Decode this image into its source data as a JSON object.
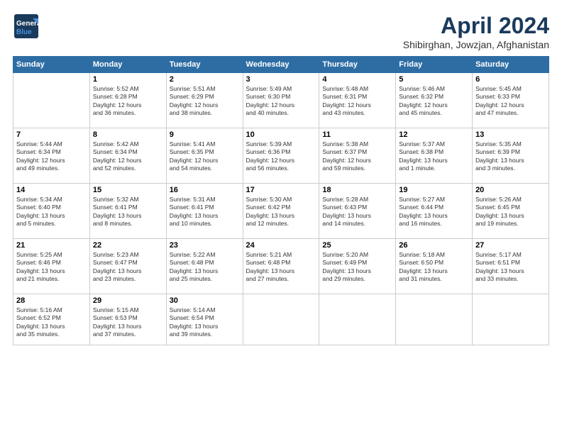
{
  "header": {
    "logo_line1": "General",
    "logo_line2": "Blue",
    "month": "April 2024",
    "location": "Shibirghan, Jowzjan, Afghanistan"
  },
  "weekdays": [
    "Sunday",
    "Monday",
    "Tuesday",
    "Wednesday",
    "Thursday",
    "Friday",
    "Saturday"
  ],
  "weeks": [
    [
      {
        "day": "",
        "text": ""
      },
      {
        "day": "1",
        "text": "Sunrise: 5:52 AM\nSunset: 6:28 PM\nDaylight: 12 hours\nand 36 minutes."
      },
      {
        "day": "2",
        "text": "Sunrise: 5:51 AM\nSunset: 6:29 PM\nDaylight: 12 hours\nand 38 minutes."
      },
      {
        "day": "3",
        "text": "Sunrise: 5:49 AM\nSunset: 6:30 PM\nDaylight: 12 hours\nand 40 minutes."
      },
      {
        "day": "4",
        "text": "Sunrise: 5:48 AM\nSunset: 6:31 PM\nDaylight: 12 hours\nand 43 minutes."
      },
      {
        "day": "5",
        "text": "Sunrise: 5:46 AM\nSunset: 6:32 PM\nDaylight: 12 hours\nand 45 minutes."
      },
      {
        "day": "6",
        "text": "Sunrise: 5:45 AM\nSunset: 6:33 PM\nDaylight: 12 hours\nand 47 minutes."
      }
    ],
    [
      {
        "day": "7",
        "text": "Sunrise: 5:44 AM\nSunset: 6:34 PM\nDaylight: 12 hours\nand 49 minutes."
      },
      {
        "day": "8",
        "text": "Sunrise: 5:42 AM\nSunset: 6:34 PM\nDaylight: 12 hours\nand 52 minutes."
      },
      {
        "day": "9",
        "text": "Sunrise: 5:41 AM\nSunset: 6:35 PM\nDaylight: 12 hours\nand 54 minutes."
      },
      {
        "day": "10",
        "text": "Sunrise: 5:39 AM\nSunset: 6:36 PM\nDaylight: 12 hours\nand 56 minutes."
      },
      {
        "day": "11",
        "text": "Sunrise: 5:38 AM\nSunset: 6:37 PM\nDaylight: 12 hours\nand 59 minutes."
      },
      {
        "day": "12",
        "text": "Sunrise: 5:37 AM\nSunset: 6:38 PM\nDaylight: 13 hours\nand 1 minute."
      },
      {
        "day": "13",
        "text": "Sunrise: 5:35 AM\nSunset: 6:39 PM\nDaylight: 13 hours\nand 3 minutes."
      }
    ],
    [
      {
        "day": "14",
        "text": "Sunrise: 5:34 AM\nSunset: 6:40 PM\nDaylight: 13 hours\nand 5 minutes."
      },
      {
        "day": "15",
        "text": "Sunrise: 5:32 AM\nSunset: 6:41 PM\nDaylight: 13 hours\nand 8 minutes."
      },
      {
        "day": "16",
        "text": "Sunrise: 5:31 AM\nSunset: 6:41 PM\nDaylight: 13 hours\nand 10 minutes."
      },
      {
        "day": "17",
        "text": "Sunrise: 5:30 AM\nSunset: 6:42 PM\nDaylight: 13 hours\nand 12 minutes."
      },
      {
        "day": "18",
        "text": "Sunrise: 5:28 AM\nSunset: 6:43 PM\nDaylight: 13 hours\nand 14 minutes."
      },
      {
        "day": "19",
        "text": "Sunrise: 5:27 AM\nSunset: 6:44 PM\nDaylight: 13 hours\nand 16 minutes."
      },
      {
        "day": "20",
        "text": "Sunrise: 5:26 AM\nSunset: 6:45 PM\nDaylight: 13 hours\nand 19 minutes."
      }
    ],
    [
      {
        "day": "21",
        "text": "Sunrise: 5:25 AM\nSunset: 6:46 PM\nDaylight: 13 hours\nand 21 minutes."
      },
      {
        "day": "22",
        "text": "Sunrise: 5:23 AM\nSunset: 6:47 PM\nDaylight: 13 hours\nand 23 minutes."
      },
      {
        "day": "23",
        "text": "Sunrise: 5:22 AM\nSunset: 6:48 PM\nDaylight: 13 hours\nand 25 minutes."
      },
      {
        "day": "24",
        "text": "Sunrise: 5:21 AM\nSunset: 6:48 PM\nDaylight: 13 hours\nand 27 minutes."
      },
      {
        "day": "25",
        "text": "Sunrise: 5:20 AM\nSunset: 6:49 PM\nDaylight: 13 hours\nand 29 minutes."
      },
      {
        "day": "26",
        "text": "Sunrise: 5:18 AM\nSunset: 6:50 PM\nDaylight: 13 hours\nand 31 minutes."
      },
      {
        "day": "27",
        "text": "Sunrise: 5:17 AM\nSunset: 6:51 PM\nDaylight: 13 hours\nand 33 minutes."
      }
    ],
    [
      {
        "day": "28",
        "text": "Sunrise: 5:16 AM\nSunset: 6:52 PM\nDaylight: 13 hours\nand 35 minutes."
      },
      {
        "day": "29",
        "text": "Sunrise: 5:15 AM\nSunset: 6:53 PM\nDaylight: 13 hours\nand 37 minutes."
      },
      {
        "day": "30",
        "text": "Sunrise: 5:14 AM\nSunset: 6:54 PM\nDaylight: 13 hours\nand 39 minutes."
      },
      {
        "day": "",
        "text": ""
      },
      {
        "day": "",
        "text": ""
      },
      {
        "day": "",
        "text": ""
      },
      {
        "day": "",
        "text": ""
      }
    ]
  ]
}
